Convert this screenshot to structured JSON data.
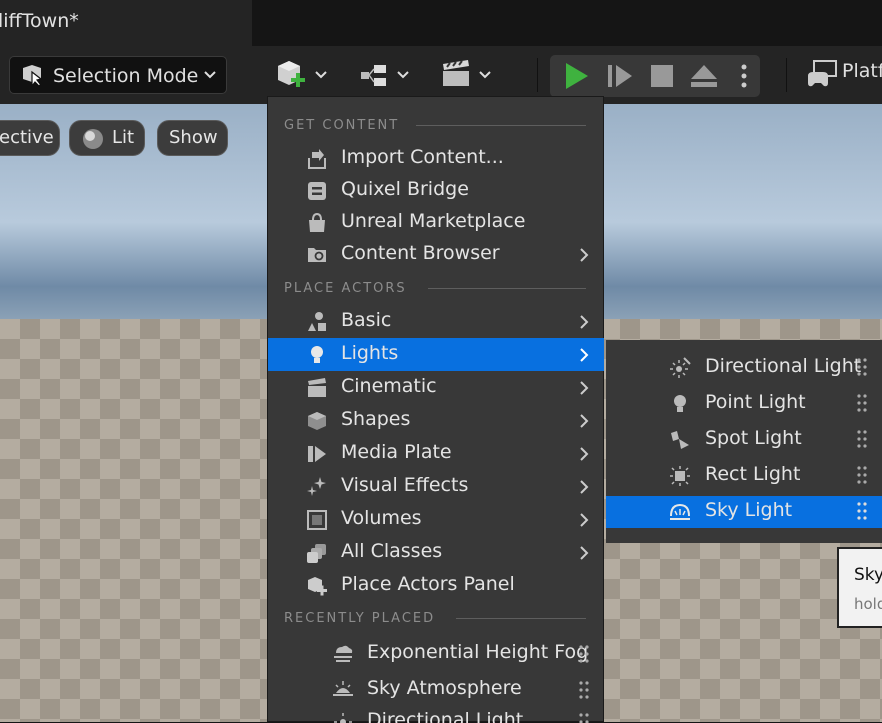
{
  "document_tab": {
    "title": "liffTown*"
  },
  "toolbar": {
    "selection_mode_label": "Selection Mode",
    "platforms_label": "Platf"
  },
  "viewport": {
    "chips": {
      "perspective": "ective",
      "lit": "Lit",
      "show": "Show"
    }
  },
  "colors": {
    "accent": "#0870e0",
    "menu_bg": "#383838",
    "play_green": "#3fb23f"
  },
  "place_menu": {
    "sections": {
      "get_content": "GET CONTENT",
      "place_actors": "PLACE ACTORS",
      "recently_placed": "RECENTLY PLACED"
    },
    "get_content_items": [
      {
        "label": "Import Content...",
        "icon": "import-icon"
      },
      {
        "label": "Quixel Bridge",
        "icon": "bridge-icon"
      },
      {
        "label": "Unreal Marketplace",
        "icon": "marketplace-icon"
      },
      {
        "label": "Content Browser",
        "icon": "folder-search-icon"
      }
    ],
    "place_actor_items": [
      {
        "label": "Basic",
        "icon": "basic-shapes-icon"
      },
      {
        "label": "Lights",
        "icon": "lightbulb-icon"
      },
      {
        "label": "Cinematic",
        "icon": "clapperboard-icon"
      },
      {
        "label": "Shapes",
        "icon": "cube-icon"
      },
      {
        "label": "Media Plate",
        "icon": "media-plate-icon"
      },
      {
        "label": "Visual Effects",
        "icon": "sparkles-icon"
      },
      {
        "label": "Volumes",
        "icon": "volume-icon"
      },
      {
        "label": "All Classes",
        "icon": "classes-icon"
      },
      {
        "label": "Place Actors Panel",
        "icon": "place-actors-icon"
      }
    ],
    "recent_items": [
      {
        "label": "Exponential Height Fog",
        "icon": "fog-icon"
      },
      {
        "label": "Sky Atmosphere",
        "icon": "sky-atmosphere-icon"
      },
      {
        "label": "Directional Light",
        "icon": "directional-light-icon"
      }
    ]
  },
  "lights_submenu": [
    {
      "label": "Directional Light",
      "icon": "directional-light-icon"
    },
    {
      "label": "Point Light",
      "icon": "point-light-icon"
    },
    {
      "label": "Spot Light",
      "icon": "spot-light-icon"
    },
    {
      "label": "Rect Light",
      "icon": "rect-light-icon"
    },
    {
      "label": "Sky Light",
      "icon": "sky-light-icon"
    }
  ],
  "tooltip": {
    "title": "Sky",
    "hint": "hold"
  }
}
